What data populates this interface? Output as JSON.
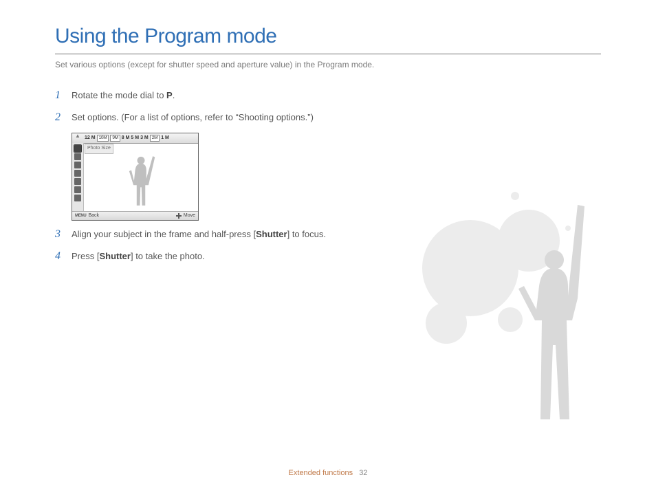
{
  "title": "Using the Program mode",
  "subtitle": "Set various options (except for shutter speed and aperture value) in the Program mode.",
  "steps": {
    "s1_pre": "Rotate the mode dial to ",
    "s1_bold": "P",
    "s1_post": ".",
    "s2": "Set options. (For a list of options, refer to “Shooting options.”)",
    "s3_pre": "Align your subject in the frame and half-press [",
    "s3_bold": "Shutter",
    "s3_post": "] to focus.",
    "s4_pre": "Press [",
    "s4_bold": "Shutter",
    "s4_post": "] to take the photo."
  },
  "step_nums": {
    "n1": "1",
    "n2": "2",
    "n3": "3",
    "n4": "4"
  },
  "screen": {
    "top_options": [
      "12 M",
      "10M",
      "9M",
      "8 M",
      "5 M",
      "3 M",
      "2M",
      "1 M"
    ],
    "label_photo_size": "Photo Size",
    "back": "Back",
    "move": "Move",
    "menu": "MENU"
  },
  "footer": {
    "section": "Extended functions",
    "page": "32"
  }
}
